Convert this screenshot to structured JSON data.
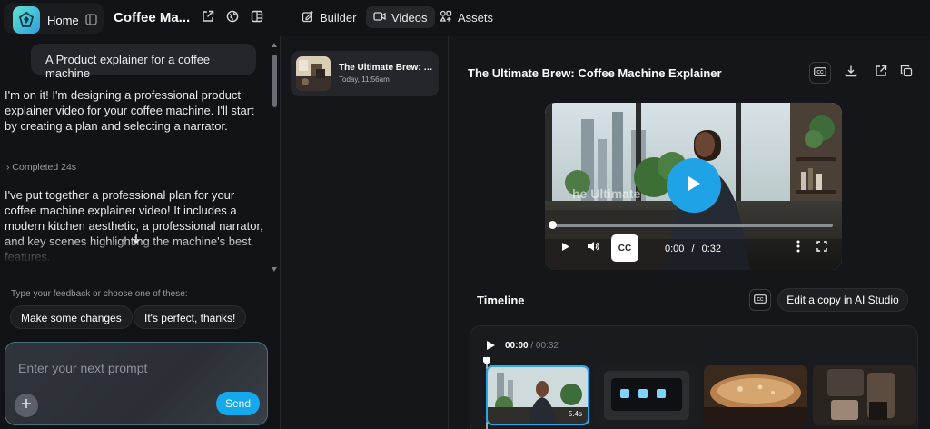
{
  "topbar": {
    "home_label": "Home",
    "project_title": "Coffee Ma...",
    "nav": [
      {
        "label": "Builder",
        "active": false
      },
      {
        "label": "Videos",
        "active": true
      },
      {
        "label": "Assets",
        "active": false
      }
    ]
  },
  "chat": {
    "user_message": "A Product explainer for a coffee machine",
    "ai_message_1": "I'm on it! I'm designing a professional product explainer video for your coffee machine. I'll start by creating a plan and selecting a narrator.",
    "completed_label": "Completed 24s",
    "ai_message_2": "I've put together a professional plan for your coffee machine explainer video! It includes a modern kitchen aesthetic, a professional narrator, and key scenes highlighting the machine's best features.",
    "feedback_hint": "Type your feedback or choose one of these:",
    "suggestions": [
      "Make some changes",
      "It's perfect, thanks!"
    ],
    "prompt_placeholder": "Enter your next prompt",
    "send_label": "Send"
  },
  "video_list": [
    {
      "title": "The Ultimate Brew: Coffee Machine Explainer",
      "time": "Today, 11:56am"
    }
  ],
  "main": {
    "title": "The Ultimate Brew: Coffee Machine Explainer",
    "player": {
      "watermark_text": "he Ultimate",
      "cc_label": "CC",
      "current_time": "0:00",
      "separator": "/",
      "duration": "0:32",
      "progress": 0
    },
    "timeline": {
      "title": "Timeline",
      "edit_copy_label": "Edit a copy in AI Studio",
      "current_time": "00:00",
      "total_time": "/ 00:32",
      "clips": [
        {
          "duration": "5.4s",
          "selected": true
        },
        {
          "duration": "",
          "selected": false
        },
        {
          "duration": "",
          "selected": false
        },
        {
          "duration": "",
          "selected": false
        }
      ]
    }
  },
  "colors": {
    "accent": "#15a8ec",
    "background": "#121316",
    "panel": "#151619",
    "bubble": "#24262b"
  }
}
